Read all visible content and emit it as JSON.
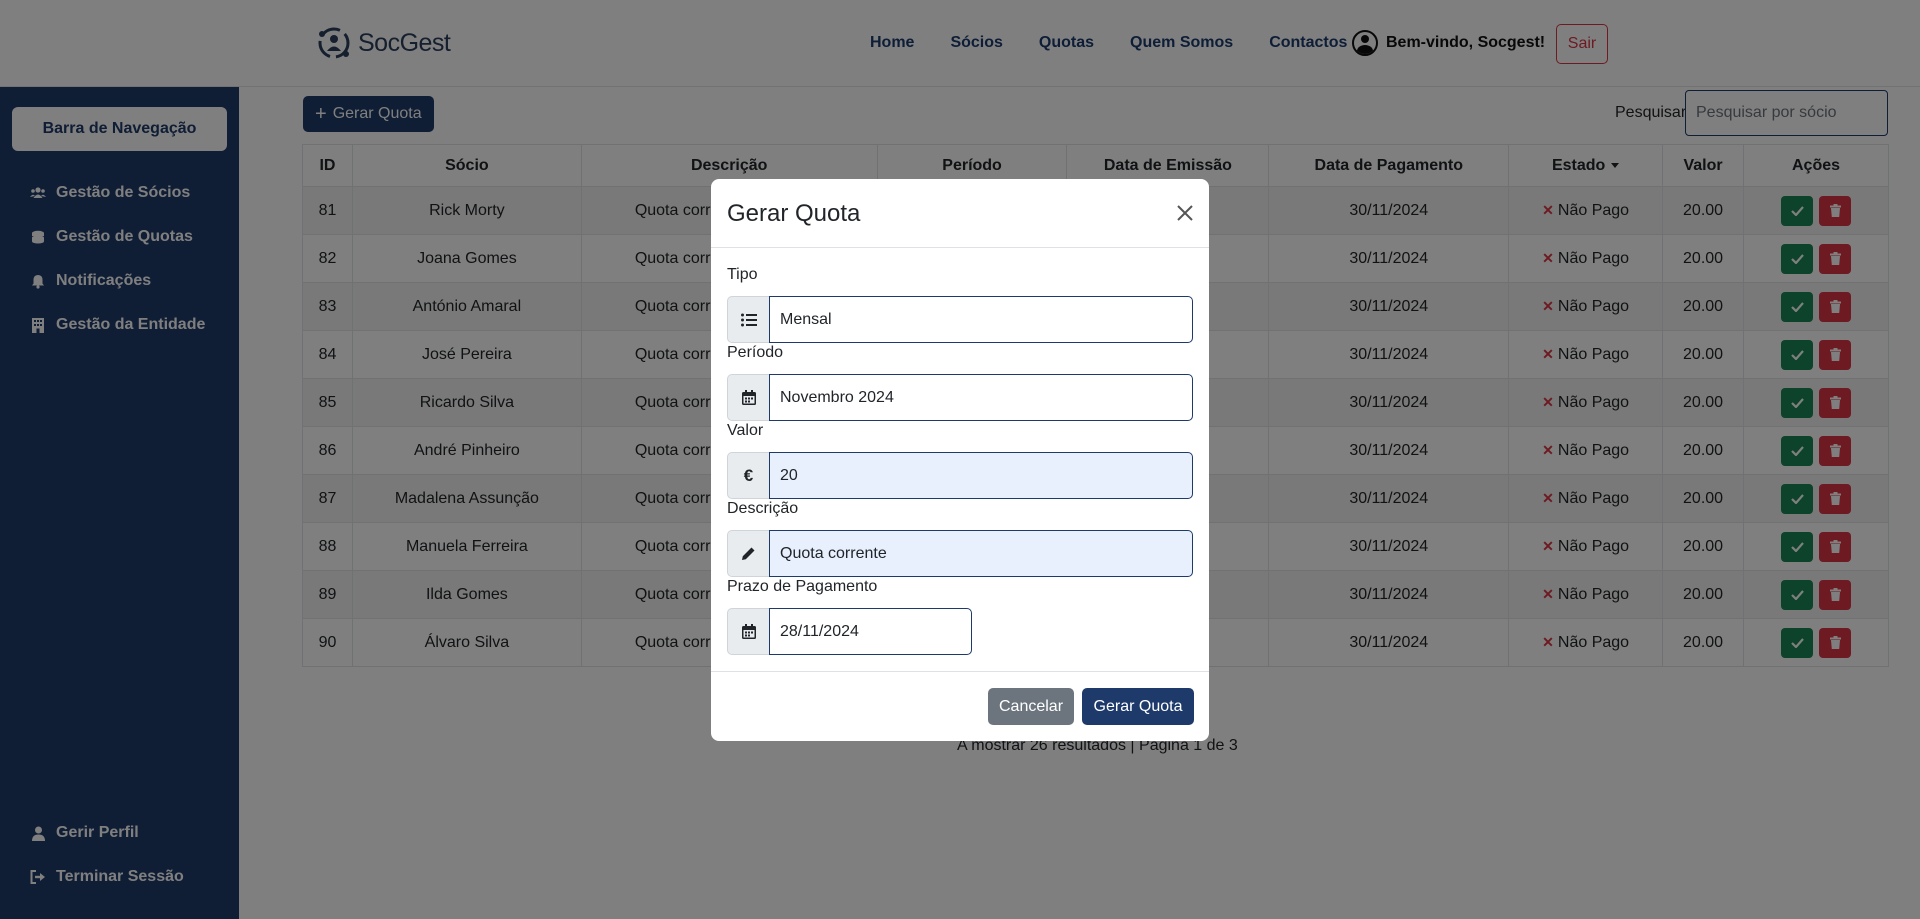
{
  "app": {
    "logo_text": "SocGest"
  },
  "topnav": {
    "links": [
      "Home",
      "Sócios",
      "Quotas",
      "Quem Somos",
      "Contactos"
    ],
    "welcome": "Bem-vindo, Socgest!",
    "logout": "Sair"
  },
  "sidebar": {
    "header": "Barra de Navegação",
    "items": [
      {
        "label": "Gestão de Sócios",
        "icon": "users-icon"
      },
      {
        "label": "Gestão de Quotas",
        "icon": "coins-icon"
      },
      {
        "label": "Notificações",
        "icon": "bell-icon"
      },
      {
        "label": "Gestão da Entidade",
        "icon": "building-icon"
      }
    ],
    "bottom_items": [
      {
        "label": "Gerir Perfil",
        "icon": "user-icon"
      },
      {
        "label": "Terminar Sessão",
        "icon": "sign-out-icon"
      }
    ]
  },
  "toolbar": {
    "generate_label": "Gerar Quota",
    "search_label": "Pesquisar:",
    "search_placeholder": "Pesquisar por sócio"
  },
  "table": {
    "headers": [
      "ID",
      "Sócio",
      "Descrição",
      "Período",
      "Data de Emissão",
      "Data de Pagamento",
      "Estado",
      "Valor",
      "Ações"
    ],
    "rows": [
      {
        "id": "81",
        "socio": "Rick Morty",
        "descricao": "Quota corr",
        "pagamento": "30/11/2024",
        "estado": "Não Pago",
        "valor": "20.00"
      },
      {
        "id": "82",
        "socio": "Joana Gomes",
        "descricao": "Quota corr",
        "pagamento": "30/11/2024",
        "estado": "Não Pago",
        "valor": "20.00"
      },
      {
        "id": "83",
        "socio": "António Amaral",
        "descricao": "Quota corr",
        "pagamento": "30/11/2024",
        "estado": "Não Pago",
        "valor": "20.00"
      },
      {
        "id": "84",
        "socio": "José Pereira",
        "descricao": "Quota corr",
        "pagamento": "30/11/2024",
        "estado": "Não Pago",
        "valor": "20.00"
      },
      {
        "id": "85",
        "socio": "Ricardo Silva",
        "descricao": "Quota corr",
        "pagamento": "30/11/2024",
        "estado": "Não Pago",
        "valor": "20.00"
      },
      {
        "id": "86",
        "socio": "André Pinheiro",
        "descricao": "Quota corr",
        "pagamento": "30/11/2024",
        "estado": "Não Pago",
        "valor": "20.00"
      },
      {
        "id": "87",
        "socio": "Madalena Assunção",
        "descricao": "Quota corr",
        "pagamento": "30/11/2024",
        "estado": "Não Pago",
        "valor": "20.00"
      },
      {
        "id": "88",
        "socio": "Manuela Ferreira",
        "descricao": "Quota corr",
        "pagamento": "30/11/2024",
        "estado": "Não Pago",
        "valor": "20.00"
      },
      {
        "id": "89",
        "socio": "Ilda Gomes",
        "descricao": "Quota corr",
        "pagamento": "30/11/2024",
        "estado": "Não Pago",
        "valor": "20.00"
      },
      {
        "id": "90",
        "socio": "Álvaro Silva",
        "descricao": "Quota corr",
        "pagamento": "30/11/2024",
        "estado": "Não Pago",
        "valor": "20.00"
      }
    ]
  },
  "pagination": {
    "info": "A mostrar 26 resultados | Página 1 de 3"
  },
  "modal": {
    "title": "Gerar Quota",
    "fields": {
      "tipo": {
        "label": "Tipo",
        "value": "Mensal",
        "icon": "list-icon"
      },
      "periodo": {
        "label": "Período",
        "value": "Novembro 2024",
        "icon": "calendar-icon"
      },
      "valor": {
        "label": "Valor",
        "value": "20",
        "icon": "euro-icon"
      },
      "descricao": {
        "label": "Descrição",
        "value": "Quota corrente",
        "icon": "pencil-icon"
      },
      "prazo": {
        "label": "Prazo de Pagamento",
        "value": "28/11/2024",
        "icon": "calendar-icon"
      }
    },
    "cancel_label": "Cancelar",
    "submit_label": "Gerar Quota"
  },
  "colors": {
    "primary": "#1e3a6b",
    "success": "#198754",
    "danger": "#dc3545",
    "secondary": "#6c757d"
  }
}
